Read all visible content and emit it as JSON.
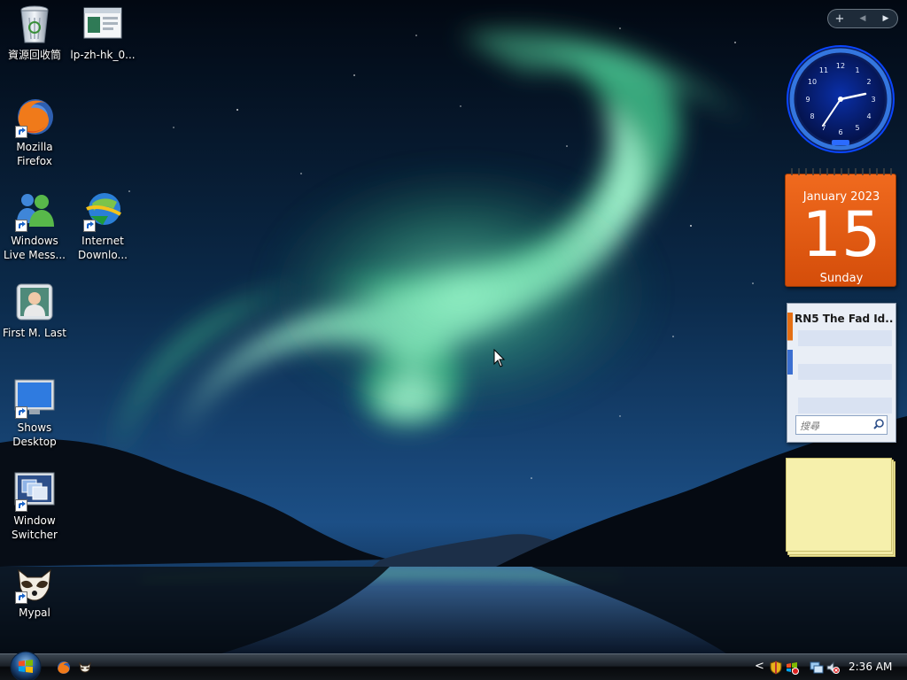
{
  "desktop": {
    "icons": [
      {
        "label": "資源回收筒",
        "icon": "recycle-bin-icon"
      },
      {
        "label": "lp-zh-hk_0...",
        "icon": "window-file-icon"
      },
      {
        "label": "Mozilla Firefox",
        "icon": "firefox-icon"
      },
      {
        "label": "Windows Live Mess...",
        "icon": "messenger-icon"
      },
      {
        "label": "Internet Downlo...",
        "icon": "internet-download-manager-icon"
      },
      {
        "label": "First M. Last",
        "icon": "user-account-icon"
      },
      {
        "label": "Shows Desktop",
        "icon": "show-desktop-icon"
      },
      {
        "label": "Window Switcher",
        "icon": "window-switcher-icon"
      },
      {
        "label": "Mypal",
        "icon": "mypal-icon"
      }
    ]
  },
  "sidebar": {
    "controls": [
      "+",
      "◀",
      "▶"
    ],
    "calendar": {
      "month": "January 2023",
      "day": "15",
      "weekday": "Sunday"
    },
    "feeds": {
      "title": "RN5 The Fad Id...",
      "search_placeholder": "搜尋"
    }
  },
  "taskbar": {
    "time": "2:36 AM",
    "tray_expand": "<",
    "quick_launch": [
      "firefox-icon",
      "mypal-icon"
    ]
  },
  "colors": {
    "calendar_orange": "#e35a12",
    "note_yellow": "#f6f0ac",
    "aurora_green": "#5fd6a0"
  }
}
